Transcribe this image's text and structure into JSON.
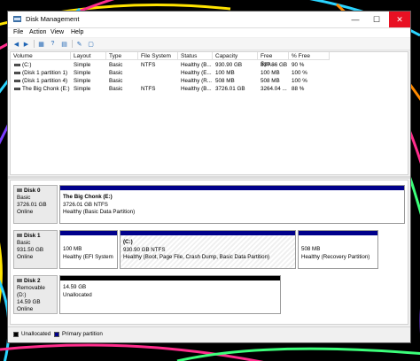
{
  "window": {
    "title": "Disk Management",
    "controls": {
      "minimize": "—",
      "maximize": "☐",
      "close": "✕"
    }
  },
  "menu": [
    "File",
    "Action",
    "View",
    "Help"
  ],
  "toolbar": [
    "back-arrow-icon",
    "forward-arrow-icon",
    "properties-icon",
    "help-icon",
    "refresh-icon",
    "settings-icon"
  ],
  "volume_table": {
    "columns": [
      "Volume",
      "Layout",
      "Type",
      "File System",
      "Status",
      "Capacity",
      "Free Spa...",
      "% Free"
    ],
    "rows": [
      [
        "(C:)",
        "Simple",
        "Basic",
        "NTFS",
        "Healthy (B...",
        "930.90 GB",
        "837.86 GB",
        "90 %"
      ],
      [
        "(Disk 1 partition 1)",
        "Simple",
        "Basic",
        "",
        "Healthy (E...",
        "100 MB",
        "100 MB",
        "100 %"
      ],
      [
        "(Disk 1 partition 4)",
        "Simple",
        "Basic",
        "",
        "Healthy (R...",
        "508 MB",
        "508 MB",
        "100 %"
      ],
      [
        "The Big Chonk (E:)",
        "Simple",
        "Basic",
        "NTFS",
        "Healthy (B...",
        "3726.01 GB",
        "3264.04 ...",
        "88 %"
      ]
    ]
  },
  "disks": {
    "disk0": {
      "name": "Disk 0",
      "type": "Basic",
      "size": "3726.01 GB",
      "status": "Online",
      "part_title": "The Big Chonk  (E:)",
      "part_size": "3726.01 GB NTFS",
      "part_status": "Healthy (Basic Data Partition)"
    },
    "disk1": {
      "name": "Disk 1",
      "type": "Basic",
      "size": "931.50 GB",
      "status": "Online",
      "p1_size": "100 MB",
      "p1_status": "Healthy (EFI System P",
      "p2_title": "(C:)",
      "p2_size": "930.90 GB NTFS",
      "p2_status": "Healthy (Boot, Page File, Crash Dump, Basic Data Partition)",
      "p3_size": "508 MB",
      "p3_status": "Healthy (Recovery Partition)"
    },
    "disk2": {
      "name": "Disk 2",
      "type": "Removable (D:)",
      "size": "14.59 GB",
      "status": "Online",
      "part_size": "14.59 GB",
      "part_status": "Unallocated"
    }
  },
  "legend": [
    {
      "label": "Unallocated",
      "color": "#000000"
    },
    {
      "label": "Primary partition",
      "color": "#00008b"
    }
  ]
}
